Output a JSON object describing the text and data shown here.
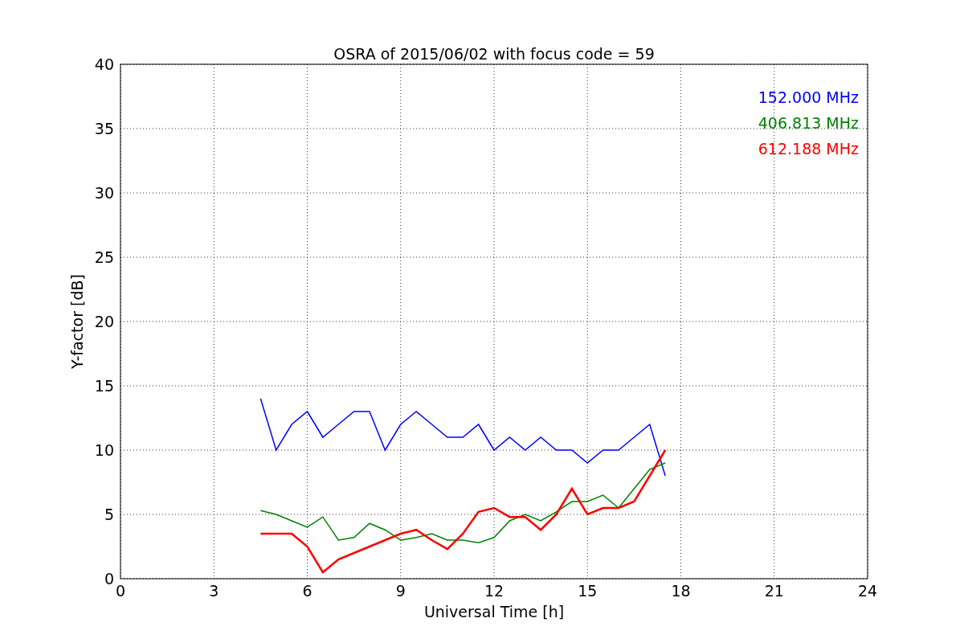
{
  "figure": {
    "chart_data": {
      "type": "line",
      "title": "OSRA of 2015/06/02 with focus code = 59",
      "xlabel": "Universal Time [h]",
      "ylabel": "Y-factor [dB]",
      "x": [
        4.5,
        5,
        5.5,
        6,
        6.5,
        7,
        7.5,
        8,
        8.5,
        9,
        9.5,
        10,
        10.5,
        11,
        11.5,
        12,
        12.5,
        13,
        13.5,
        14,
        14.5,
        15,
        15.5,
        16,
        16.5,
        17,
        17.5
      ],
      "series": [
        {
          "name": "152.000 MHz",
          "color": "#0000ff",
          "values": [
            14,
            10,
            12,
            13,
            11,
            12,
            13,
            13,
            10,
            12,
            13,
            12,
            11,
            11,
            12,
            10,
            11,
            10,
            11,
            10,
            10,
            9,
            10,
            10,
            11,
            12,
            8
          ]
        },
        {
          "name": "406.813 MHz",
          "color": "#008000",
          "values": [
            5.3,
            5,
            4.5,
            4,
            4.8,
            3,
            3.2,
            4.3,
            3.8,
            3,
            3.2,
            3.5,
            3,
            3,
            2.8,
            3.2,
            4.5,
            5,
            4.5,
            5.2,
            6,
            6,
            6.5,
            5.5,
            7,
            8.5,
            9
          ]
        },
        {
          "name": "612.188 MHz",
          "color": "#ff0000",
          "values": [
            3.5,
            3.5,
            3.5,
            2.5,
            0.5,
            1.5,
            2,
            2.5,
            3,
            3.5,
            3.8,
            3,
            2.3,
            3.5,
            5.2,
            5.5,
            4.8,
            4.8,
            3.8,
            5,
            7,
            5,
            5.5,
            5.5,
            6,
            8,
            10
          ]
        }
      ],
      "grid": true,
      "xlim": [
        0,
        24
      ],
      "ylim": [
        0,
        40
      ],
      "xticks": [
        0,
        3,
        6,
        9,
        12,
        15,
        18,
        21,
        24
      ],
      "yticks": [
        0,
        5,
        10,
        15,
        20,
        25,
        30,
        35,
        40
      ]
    }
  }
}
